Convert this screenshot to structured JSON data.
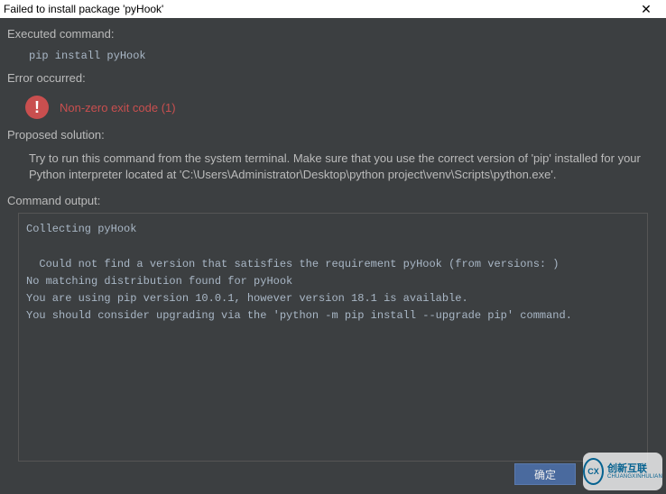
{
  "titlebar": {
    "title": "Failed to install package 'pyHook'",
    "close": "✕"
  },
  "labels": {
    "executed": "Executed command:",
    "error": "Error occurred:",
    "proposed": "Proposed solution:",
    "output": "Command output:"
  },
  "command": "pip install pyHook",
  "error_text": "Non-zero exit code (1)",
  "solution": "Try to run this command from the system terminal. Make sure that you use the correct version of 'pip' installed for your Python interpreter located at 'C:\\Users\\Administrator\\Desktop\\python project\\venv\\Scripts\\python.exe'.",
  "output": "Collecting pyHook\n\n  Could not find a version that satisfies the requirement pyHook (from versions: )\nNo matching distribution found for pyHook\nYou are using pip version 10.0.1, however version 18.1 is available.\nYou should consider upgrading via the 'python -m pip install --upgrade pip' command.",
  "buttons": {
    "ok": "确定"
  },
  "watermark": {
    "inner": "CX",
    "main": "创新互联",
    "sub": "CHUANGXINHULIAN"
  }
}
